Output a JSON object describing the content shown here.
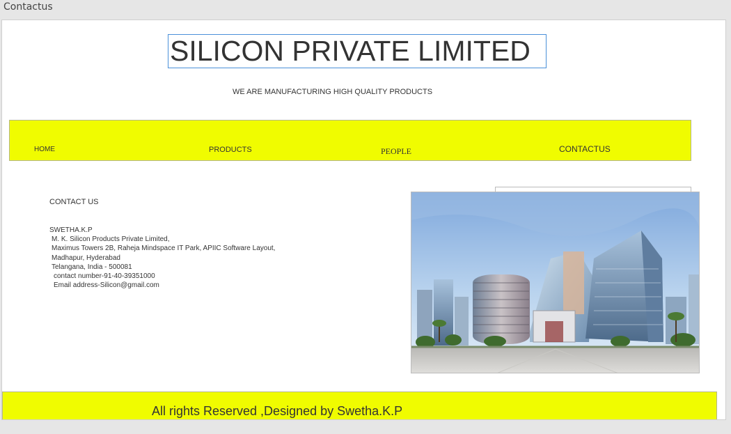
{
  "window": {
    "tab_title": "Contactus"
  },
  "header": {
    "title": "SILICON PRIVATE LIMITED",
    "tagline": "WE ARE MANUFACTURING HIGH QUALITY PRODUCTS"
  },
  "nav": {
    "items": [
      {
        "label": "HOME"
      },
      {
        "label": "PRODUCTS"
      },
      {
        "label": "PEOPLE"
      },
      {
        "label": "CONTACTUS"
      }
    ]
  },
  "contact": {
    "heading": "CONTACT US",
    "name": "SWETHA.K.P",
    "company": "M. K. Silicon Products Private Limited,",
    "address1": "Maximus Towers 2B, Raheja Mindspace IT Park, APIIC Software Layout,",
    "address2": "Madhapur, Hyderabad",
    "address3": "Telangana, India - 500081",
    "phone": "contact number-91-40-39351000",
    "email": "Email address-Silicon@gmail.com"
  },
  "footer": {
    "text": "All rights Reserved ,Designed by Swetha.K.P"
  },
  "colors": {
    "banner": "#f0fc00",
    "title_border": "#4a90d9",
    "text": "#333333"
  }
}
